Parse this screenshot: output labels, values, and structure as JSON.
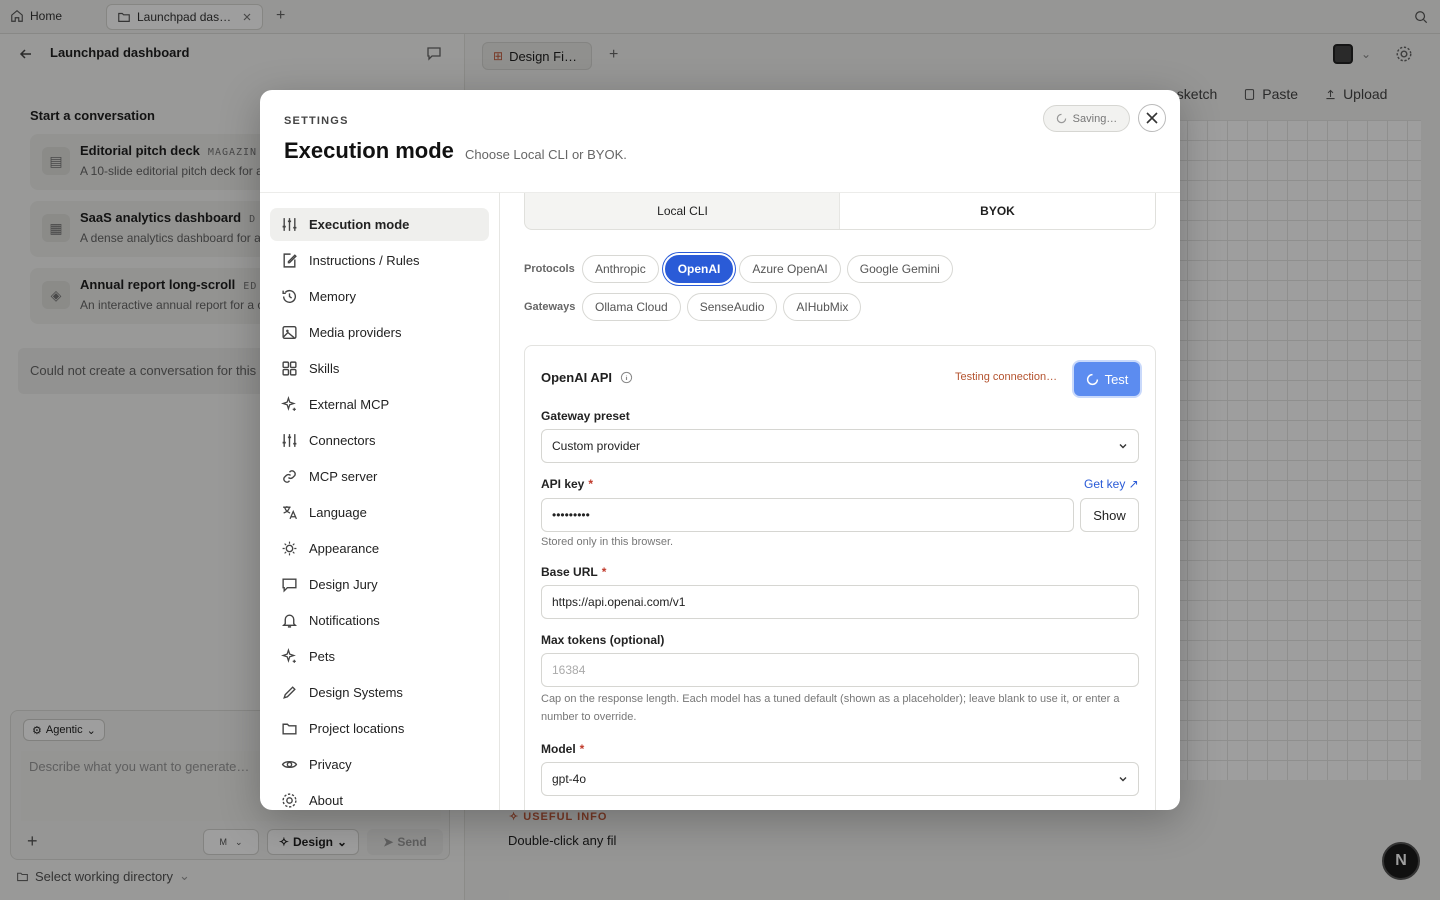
{
  "browser": {
    "home_label": "Home",
    "active_tab_label": "Launchpad dash…"
  },
  "left_panel": {
    "title": "Launchpad dashboard",
    "start_heading": "Start a conversation",
    "templates": [
      {
        "title": "Editorial pitch deck",
        "tag": "MAGAZIN",
        "desc": "A 10-slide editorial pitch deck for a",
        "icon": "document-icon"
      },
      {
        "title": "SaaS analytics dashboard",
        "tag": "D",
        "desc": "A dense analytics dashboard for a",
        "icon": "grid-icon"
      },
      {
        "title": "Annual report long-scroll",
        "tag": "ED",
        "desc": "An interactive annual report for a c",
        "icon": "diamond-icon"
      }
    ],
    "error": "Could not create a conversation for this",
    "composer": {
      "mode": "Agentic",
      "placeholder": "Describe what you want to generate…",
      "model": "M",
      "design_label": "Design",
      "send_label": "Send"
    },
    "workdir": "Select working directory"
  },
  "right_panel": {
    "tab_label": "Design Fi…",
    "actions": [
      "ew sketch",
      "Paste",
      "Upload"
    ],
    "useful_info_heading": "USEFUL INFO",
    "useful_info_text": "Double-click any fil",
    "fab_label": "N"
  },
  "modal": {
    "kicker": "SETTINGS",
    "title": "Execution mode",
    "subtitle": "Choose Local CLI or BYOK.",
    "saving": "Saving…",
    "nav": [
      {
        "label": "Execution mode",
        "icon": "sliders-icon",
        "active": true
      },
      {
        "label": "Instructions / Rules",
        "icon": "edit-icon"
      },
      {
        "label": "Memory",
        "icon": "history-icon"
      },
      {
        "label": "Media providers",
        "icon": "image-icon"
      },
      {
        "label": "Skills",
        "icon": "grid-icon"
      },
      {
        "label": "External MCP",
        "icon": "sparkle-icon"
      },
      {
        "label": "Connectors",
        "icon": "sliders-icon"
      },
      {
        "label": "MCP server",
        "icon": "link-icon"
      },
      {
        "label": "Language",
        "icon": "translate-icon"
      },
      {
        "label": "Appearance",
        "icon": "sun-icon"
      },
      {
        "label": "Design Jury",
        "icon": "chat-icon"
      },
      {
        "label": "Notifications",
        "icon": "bell-icon"
      },
      {
        "label": "Pets",
        "icon": "sparkle-icon"
      },
      {
        "label": "Design Systems",
        "icon": "pen-icon"
      },
      {
        "label": "Project locations",
        "icon": "folder-icon"
      },
      {
        "label": "Privacy",
        "icon": "eye-icon"
      },
      {
        "label": "About",
        "icon": "gear-icon"
      }
    ],
    "segments": [
      "Local CLI",
      "BYOK"
    ],
    "active_segment": "BYOK",
    "protocols_label": "Protocols",
    "protocols": [
      "Anthropic",
      "OpenAI",
      "Azure OpenAI",
      "Google Gemini"
    ],
    "selected_protocol": "OpenAI",
    "gateways_label": "Gateways",
    "gateways": [
      "Ollama Cloud",
      "SenseAudio",
      "AIHubMix"
    ],
    "card": {
      "title": "OpenAI API",
      "status": "Testing connection…",
      "test_label": "Test",
      "gateway_preset_label": "Gateway preset",
      "gateway_preset_value": "Custom provider",
      "api_key_label": "API key",
      "required_mark": "*",
      "get_key_label": "Get key ↗",
      "api_key_value": "•••••••••",
      "show_label": "Show",
      "api_key_hint": "Stored only in this browser.",
      "base_url_label": "Base URL",
      "base_url_value": "https://api.openai.com/v1",
      "max_tokens_label": "Max tokens (optional)",
      "max_tokens_placeholder": "16384",
      "max_tokens_hint": "Cap on the response length. Each model has a tuned default (shown as a placeholder); leave blank to use it, or enter a number to override.",
      "model_label": "Model",
      "model_value": "gpt-4o"
    }
  }
}
